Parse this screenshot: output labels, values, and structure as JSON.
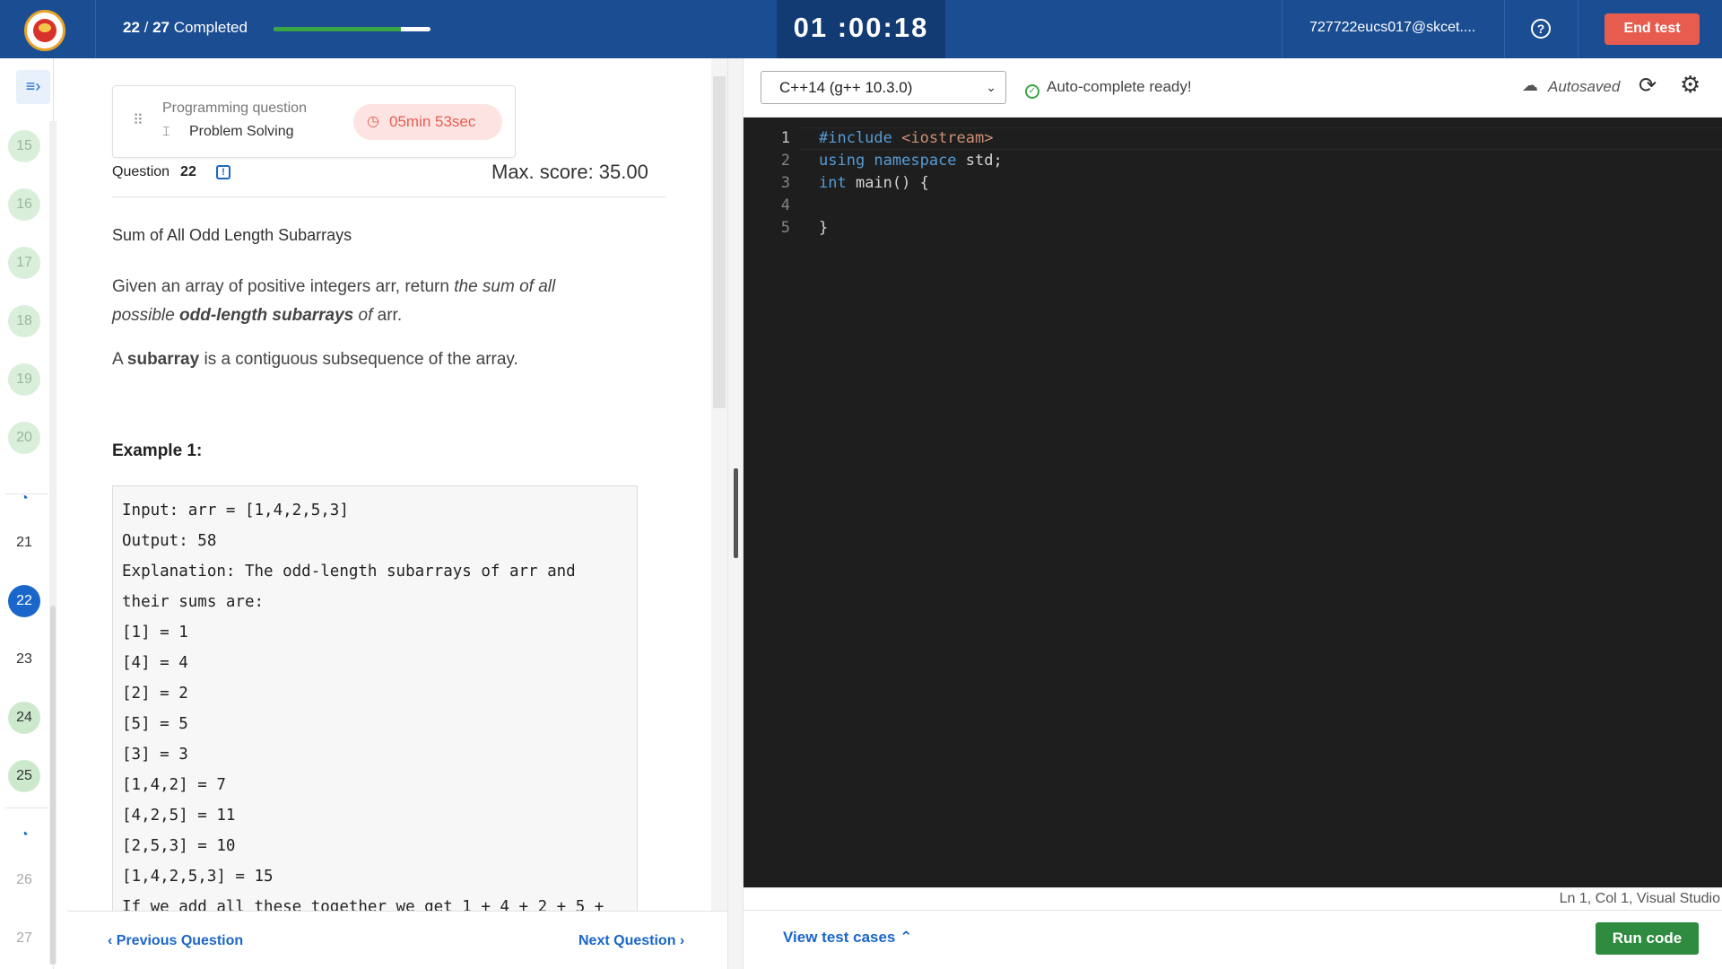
{
  "header": {
    "progress_current": "22",
    "progress_total": "27",
    "progress_suffix": "Completed",
    "progress_fraction": 0.81,
    "timer": "01 :00:18",
    "user_email": "727722eucs017@skcet....",
    "help_icon": "question-circle-icon",
    "end_test_label": "End test",
    "colors": {
      "bar": "#1b4d93",
      "end_test": "#e85c50",
      "progress_fill": "#3aa545"
    }
  },
  "qnav": {
    "toggle_icon": "menu-arrow-icon",
    "items": [
      {
        "num": "15",
        "state": "done-faded"
      },
      {
        "num": "16",
        "state": "done-faded"
      },
      {
        "num": "17",
        "state": "done-faded"
      },
      {
        "num": "18",
        "state": "done-faded"
      },
      {
        "num": "19",
        "state": "done-faded"
      },
      {
        "num": "20",
        "state": "done-faded"
      },
      {
        "num": "21",
        "state": "plain"
      },
      {
        "num": "22",
        "state": "active"
      },
      {
        "num": "23",
        "state": "plain"
      },
      {
        "num": "24",
        "state": "done"
      },
      {
        "num": "25",
        "state": "done"
      },
      {
        "num": "26",
        "state": "plain-faded"
      },
      {
        "num": "27",
        "state": "plain-faded"
      }
    ]
  },
  "question": {
    "type": "Programming question",
    "topic": "Problem Solving",
    "time_left": "05min 53sec",
    "label": "Question",
    "number": "22",
    "max_score": "Max. score: 35.00",
    "title": "Sum of All Odd Length Subarrays",
    "desc_plain1": "Given an array of positive integers arr, return ",
    "desc_italic1": "the sum of all possible ",
    "desc_bold_italic": "odd-length subarrays",
    "desc_italic2": " of ",
    "desc_plain2": "arr.",
    "sub_prefix": "A ",
    "sub_bold": "subarray",
    "sub_rest": " is a contiguous subsequence of the array.",
    "example_title": "Example 1:",
    "example_code": "Input: arr = [1,4,2,5,3]\nOutput: 58\nExplanation: The odd-length subarrays of arr and their sums are:\n[1] = 1\n[4] = 4\n[2] = 2\n[5] = 5\n[3] = 3\n[1,4,2] = 7\n[4,2,5] = 11\n[2,5,3] = 10\n[1,4,2,5,3] = 15\nIf we add all these together we get 1 + 4 + 2 + 5 +"
  },
  "nav": {
    "prev": "Previous Question",
    "next": "Next Question"
  },
  "editor": {
    "language": "C++14 (g++ 10.3.0)",
    "autocomplete": "Auto-complete ready!",
    "autosaved": "Autosaved",
    "lines": [
      {
        "n": "1",
        "include_kw": "#include",
        "include_val": " <iostream>"
      },
      {
        "n": "2",
        "kw1": "using",
        "kw2": " namespace",
        "rest": " std;"
      },
      {
        "n": "3",
        "kw": "int",
        "rest": " main() {"
      },
      {
        "n": "4",
        "text": ""
      },
      {
        "n": "5",
        "text": "}"
      }
    ],
    "status": "Ln 1, Col 1, Visual Studio",
    "view_tests": "View test cases",
    "run_code": "Run code"
  }
}
